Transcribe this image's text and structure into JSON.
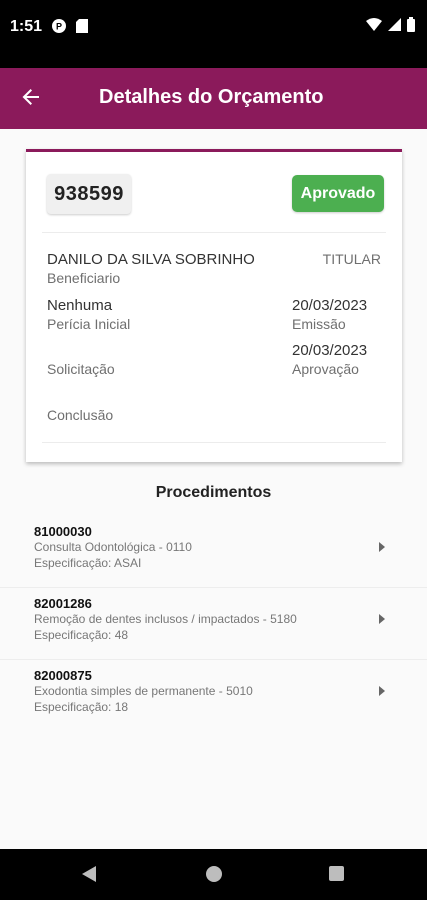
{
  "status_bar": {
    "time": "1:51",
    "icons": [
      "app-notification-icon",
      "sim-card-icon",
      "wifi-icon",
      "signal-icon",
      "battery-icon"
    ]
  },
  "app_bar": {
    "title": "Detalhes do Orçamento",
    "back_icon": "arrow-left-icon"
  },
  "budget": {
    "code": "938599",
    "status": "Aprovado",
    "beneficiary_name": "DANILO DA SILVA SOBRINHO",
    "beneficiary_label": "Beneficiario",
    "beneficiary_type": "TITULAR",
    "pericia_value": "Nenhuma",
    "pericia_label": "Perícia Inicial",
    "emissao_value": "20/03/2023",
    "emissao_label": "Emissão",
    "aprovacao_value": "20/03/2023",
    "aprovacao_label": "Aprovação",
    "solicitacao_label": "Solicitação",
    "conclusao_label": "Conclusão"
  },
  "procedures": {
    "title": "Procedimentos",
    "items": [
      {
        "code": "81000030",
        "description": "Consulta Odontológica - 0110",
        "spec": "Especificação: ASAI"
      },
      {
        "code": "82001286",
        "description": "Remoção de dentes inclusos / impactados - 5180",
        "spec": "Especificação: 48"
      },
      {
        "code": "82000875",
        "description": "Exodontia simples de permanente - 5010",
        "spec": "Especificação: 18"
      }
    ]
  },
  "colors": {
    "primary": "#8b1a5b",
    "approved": "#4caf50"
  },
  "nav_bar": {
    "icons": [
      "nav-back-icon",
      "nav-home-icon",
      "nav-recents-icon"
    ]
  }
}
